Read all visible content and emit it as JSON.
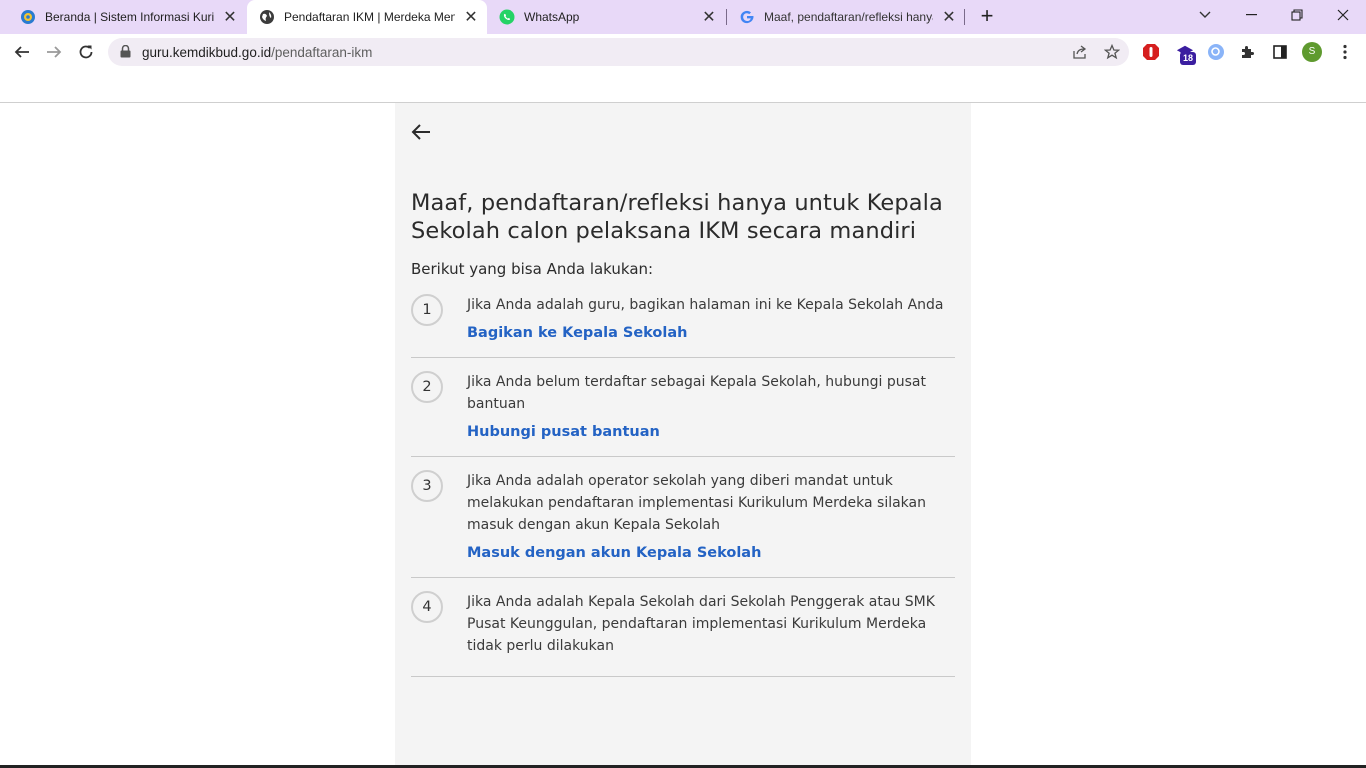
{
  "browser": {
    "tabs": [
      {
        "title": "Beranda | Sistem Informasi Kurikulum",
        "favicon": "kemdikbud-logo-icon",
        "active": false
      },
      {
        "title": "Pendaftaran IKM | Merdeka Mengajar",
        "favicon": "globe-icon",
        "active": true
      },
      {
        "title": "WhatsApp",
        "favicon": "whatsapp-icon",
        "active": false
      },
      {
        "title": "Maaf, pendaftaran/refleksi hanya untuk",
        "favicon": "google-icon",
        "active": false
      }
    ],
    "url_host": "guru.kemdikbud.go.id",
    "url_path": "/pendaftaran-ikm",
    "extension_badge": "18",
    "profile_initial": "S",
    "colors": {
      "tabstrip": "#e8d9f8",
      "accent_link": "#2463c4"
    }
  },
  "page": {
    "heading": "Maaf, pendaftaran/refleksi hanya untuk Kepala Sekolah calon pelaksana IKM secara mandiri",
    "subtitle": "Berikut yang bisa Anda lakukan:",
    "steps": [
      {
        "number": "1",
        "text": "Jika Anda adalah guru, bagikan halaman ini ke Kepala Sekolah Anda",
        "link": "Bagikan ke Kepala Sekolah"
      },
      {
        "number": "2",
        "text": "Jika Anda belum terdaftar sebagai Kepala Sekolah, hubungi pusat bantuan",
        "link": "Hubungi pusat bantuan"
      },
      {
        "number": "3",
        "text": "Jika Anda adalah operator sekolah yang diberi mandat untuk melakukan pendaftaran implementasi Kurikulum Merdeka silakan masuk dengan akun Kepala Sekolah",
        "link": "Masuk dengan akun Kepala Sekolah"
      },
      {
        "number": "4",
        "text": "Jika Anda adalah Kepala Sekolah dari Sekolah Penggerak atau SMK Pusat Keunggulan, pendaftaran implementasi Kurikulum Merdeka tidak perlu dilakukan",
        "link": ""
      }
    ]
  }
}
